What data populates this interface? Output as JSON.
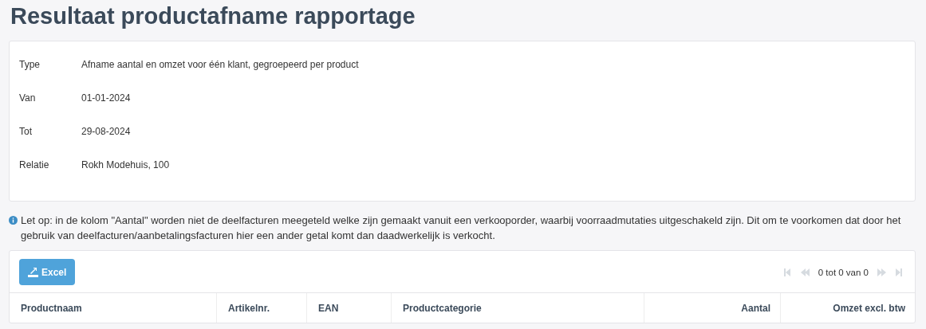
{
  "title": "Resultaat productafname rapportage",
  "details": [
    {
      "label": "Type",
      "value": "Afname aantal en omzet voor één klant, gegroepeerd per product"
    },
    {
      "label": "Van",
      "value": "01-01-2024"
    },
    {
      "label": "Tot",
      "value": "29-08-2024"
    },
    {
      "label": "Relatie",
      "value": "Rokh Modehuis, 100"
    }
  ],
  "notice": "Let op: in de kolom \"Aantal\" worden niet de deelfacturen meegeteld welke zijn gemaakt vanuit een verkooporder, waarbij voorraadmutaties uitgeschakeld zijn. Dit om te voorkomen dat door het gebruik van deelfacturen/aanbetalingsfacturen hier een ander getal komt dan daadwerkelijk is verkocht.",
  "toolbar": {
    "export_button": "Excel",
    "pager": {
      "range": "0 tot 0 van 0",
      "first_disabled": true,
      "prev_disabled": true,
      "next_disabled": true,
      "last_disabled": true
    }
  },
  "table": {
    "columns": [
      {
        "label": "Productnaam",
        "numeric": false
      },
      {
        "label": "Artikelnr.",
        "numeric": false
      },
      {
        "label": "EAN",
        "numeric": false
      },
      {
        "label": "Productcategorie",
        "numeric": false
      },
      {
        "label": "Aantal",
        "numeric": true
      },
      {
        "label": "Omzet excl. btw",
        "numeric": true
      }
    ]
  }
}
